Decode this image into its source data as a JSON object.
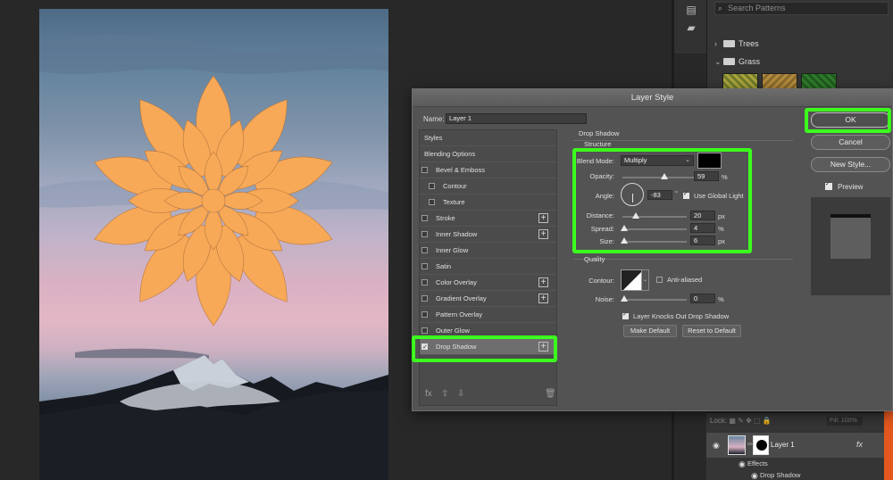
{
  "patterns": {
    "search_placeholder": "Search Patterns",
    "groups": [
      {
        "label": "Trees",
        "expanded": false
      },
      {
        "label": "Grass",
        "expanded": true
      }
    ]
  },
  "dialog": {
    "title": "Layer Style",
    "name_label": "Name:",
    "name_value": "Layer 1",
    "styles": [
      {
        "label": "Styles",
        "checkbox": false,
        "plus": false,
        "indent": false,
        "checked": false
      },
      {
        "label": "Blending Options",
        "checkbox": false,
        "plus": false,
        "indent": false,
        "checked": false
      },
      {
        "label": "Bevel & Emboss",
        "checkbox": true,
        "plus": false,
        "indent": false,
        "checked": false
      },
      {
        "label": "Contour",
        "checkbox": true,
        "plus": false,
        "indent": true,
        "checked": false
      },
      {
        "label": "Texture",
        "checkbox": true,
        "plus": false,
        "indent": true,
        "checked": false
      },
      {
        "label": "Stroke",
        "checkbox": true,
        "plus": true,
        "indent": false,
        "checked": false
      },
      {
        "label": "Inner Shadow",
        "checkbox": true,
        "plus": true,
        "indent": false,
        "checked": false
      },
      {
        "label": "Inner Glow",
        "checkbox": true,
        "plus": false,
        "indent": false,
        "checked": false
      },
      {
        "label": "Satin",
        "checkbox": true,
        "plus": false,
        "indent": false,
        "checked": false
      },
      {
        "label": "Color Overlay",
        "checkbox": true,
        "plus": true,
        "indent": false,
        "checked": false
      },
      {
        "label": "Gradient Overlay",
        "checkbox": true,
        "plus": true,
        "indent": false,
        "checked": false
      },
      {
        "label": "Pattern Overlay",
        "checkbox": true,
        "plus": false,
        "indent": false,
        "checked": false
      },
      {
        "label": "Outer Glow",
        "checkbox": true,
        "plus": false,
        "indent": false,
        "checked": false
      },
      {
        "label": "Drop Shadow",
        "checkbox": true,
        "plus": true,
        "indent": false,
        "checked": true,
        "active": true
      }
    ],
    "drop_shadow": {
      "section_title": "Drop Shadow",
      "structure_title": "Structure",
      "blend_mode_label": "Blend Mode:",
      "blend_mode_value": "Multiply",
      "shadow_color": "#000000",
      "opacity_label": "Opacity:",
      "opacity_value": "59",
      "opacity_unit": "%",
      "opacity_level": 0.59,
      "angle_label": "Angle:",
      "angle_value": "-83",
      "angle_unit": "°",
      "use_global_light_label": "Use Global Light",
      "use_global_light": true,
      "distance_label": "Distance:",
      "distance_value": "20",
      "distance_unit": "px",
      "spread_label": "Spread:",
      "spread_value": "4",
      "spread_unit": "%",
      "size_label": "Size:",
      "size_value": "6",
      "size_unit": "px",
      "quality_title": "Quality",
      "contour_label": "Contour:",
      "anti_aliased_label": "Anti-aliased",
      "anti_aliased": false,
      "noise_label": "Noise:",
      "noise_value": "0",
      "noise_unit": "%",
      "knocks_out_label": "Layer Knocks Out Drop Shadow",
      "knocks_out": true,
      "make_default_label": "Make Default",
      "reset_default_label": "Reset to Default"
    },
    "buttons": {
      "ok": "OK",
      "cancel": "Cancel",
      "new_style": "New Style...",
      "preview_label": "Preview"
    }
  },
  "layers": {
    "lock_label": "Lock:",
    "fill_label": "Fill: 100%",
    "layer_name": "Layer 1",
    "fx_label": "fx",
    "effects_label": "Effects",
    "drop_shadow_label": "Drop Shadow"
  },
  "colors": {
    "highlight": "#3cff1e",
    "flower": "#f7a958",
    "accent_strip": "#e4571e"
  }
}
